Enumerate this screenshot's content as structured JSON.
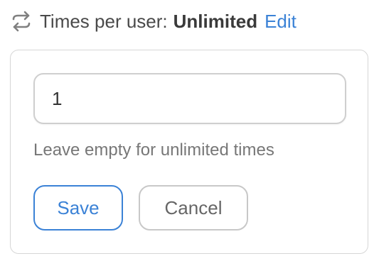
{
  "header": {
    "icon": "repeat-icon",
    "label": "Times per user:",
    "value": "Unlimited",
    "edit_label": "Edit"
  },
  "form": {
    "input_value": "1",
    "hint": "Leave empty for unlimited times",
    "save_label": "Save",
    "cancel_label": "Cancel"
  },
  "colors": {
    "accent": "#3b82d6",
    "text": "#4a4a4a",
    "muted": "#777777",
    "border": "#d6d6d6"
  }
}
